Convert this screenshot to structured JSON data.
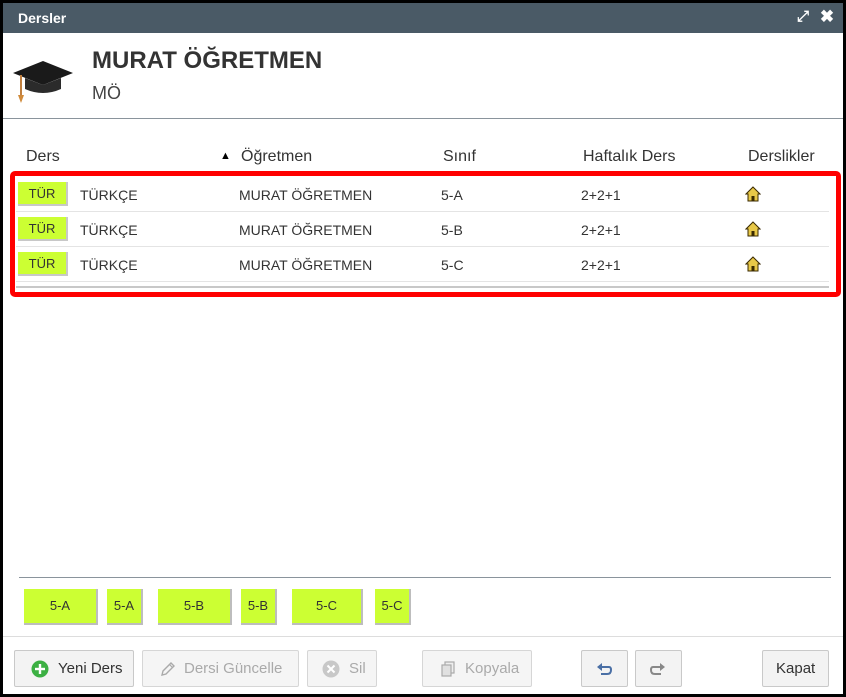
{
  "window": {
    "title": "Dersler"
  },
  "teacher": {
    "name": "MURAT ÖĞRETMEN",
    "short": "MÖ"
  },
  "columns": {
    "ders": "Ders",
    "ogretmen": "Öğretmen",
    "sinif": "Sınıf",
    "haftalik": "Haftalık Ders",
    "derslikler": "Derslikler"
  },
  "rows": [
    {
      "tag": "TÜR",
      "ders": "TÜRKÇE",
      "ogretmen": "MURAT ÖĞRETMEN",
      "sinif": "5-A",
      "haftalik": "2+2+1",
      "icon": "home-icon"
    },
    {
      "tag": "TÜR",
      "ders": "TÜRKÇE",
      "ogretmen": "MURAT ÖĞRETMEN",
      "sinif": "5-B",
      "haftalik": "2+2+1",
      "icon": "home-icon"
    },
    {
      "tag": "TÜR",
      "ders": "TÜRKÇE",
      "ogretmen": "MURAT ÖĞRETMEN",
      "sinif": "5-C",
      "haftalik": "2+2+1",
      "icon": "home-icon"
    }
  ],
  "chips": [
    "5-A",
    "5-A",
    "5-B",
    "5-B",
    "5-C",
    "5-C"
  ],
  "buttons": {
    "new": "Yeni Ders",
    "update": "Dersi Güncelle",
    "delete": "Sil",
    "copy": "Kopyala",
    "close": "Kapat"
  },
  "colors": {
    "titlebar": "#4a5a66",
    "tag": "#ccff33",
    "highlight": "#ff0000",
    "add": "#3cb043"
  }
}
